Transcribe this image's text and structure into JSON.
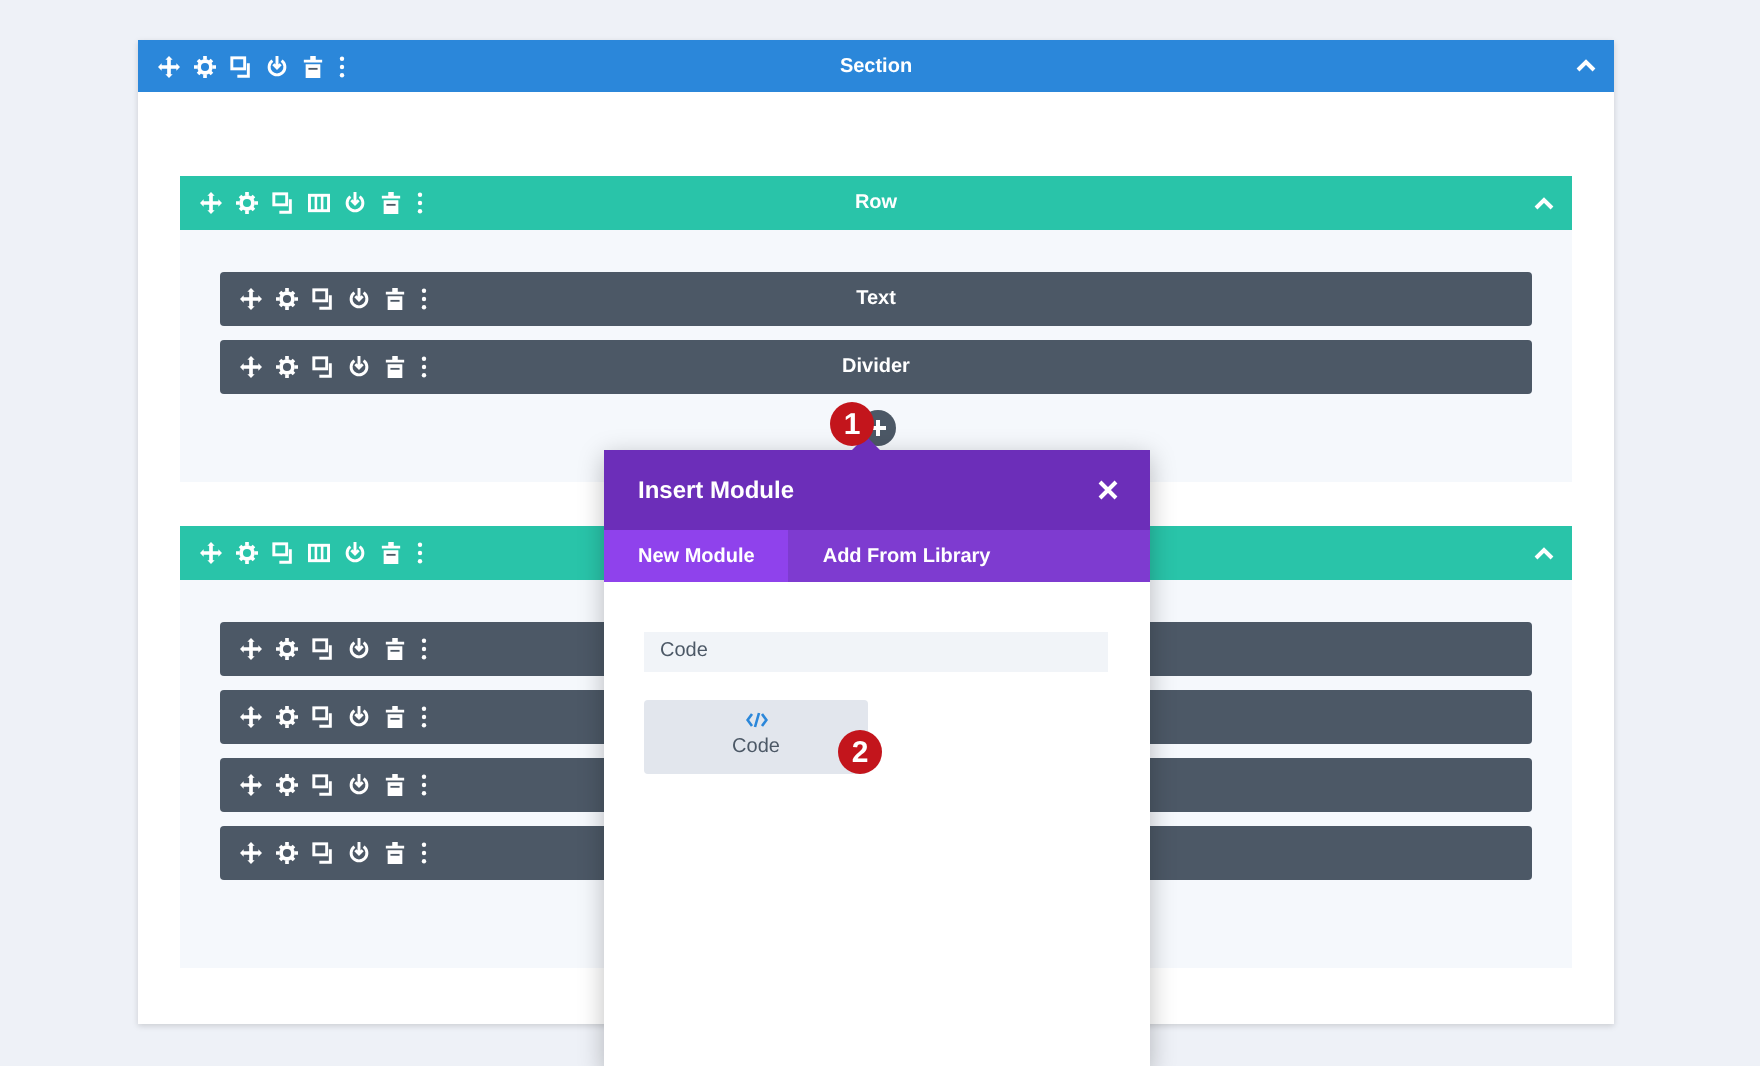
{
  "section": {
    "title": "Section",
    "expanded": true
  },
  "rows": [
    {
      "title": "Row",
      "expanded": true,
      "modules": [
        {
          "kind": "module",
          "title": "Text"
        },
        {
          "kind": "module",
          "title": "Divider"
        }
      ]
    },
    {
      "expanded": true,
      "modules": [
        {
          "kind": "module"
        },
        {
          "kind": "module"
        },
        {
          "kind": "module"
        },
        {
          "kind": "module"
        }
      ]
    }
  ],
  "insert_module": {
    "title": "Insert Module",
    "tabs": [
      {
        "label": "New Module",
        "selected": true
      },
      {
        "label": "Add From Library",
        "selected": false
      }
    ],
    "search": {
      "value": "Code"
    },
    "results": [
      {
        "label": "Code"
      }
    ]
  },
  "step_badges": [
    "1",
    "2"
  ]
}
